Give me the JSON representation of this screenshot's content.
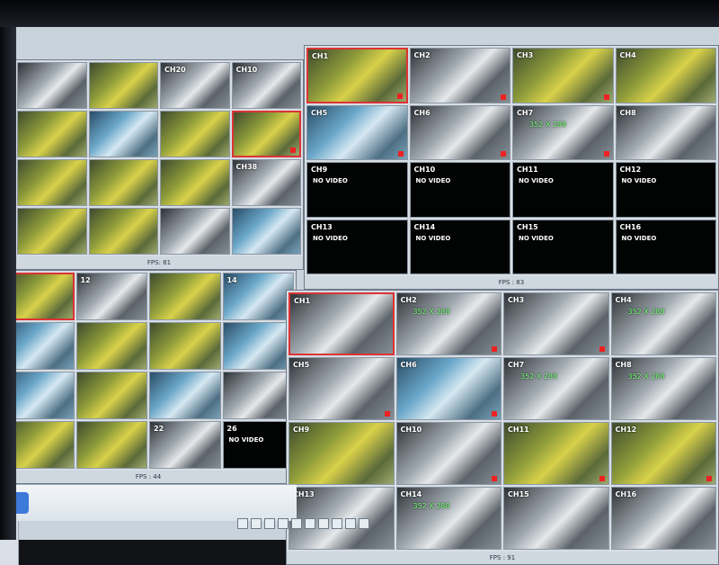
{
  "quad1": {
    "channels": [
      "",
      "",
      "CH20",
      "CH10",
      "",
      "",
      "",
      "",
      "",
      "",
      "",
      "CH38",
      "",
      "",
      "",
      ""
    ],
    "status": "FPS: 81"
  },
  "quad2": {
    "channels": [
      "CH1",
      "CH2",
      "CH3",
      "CH4",
      "CH5",
      "CH6",
      "CH7",
      "CH8",
      "CH9",
      "CH10",
      "CH11",
      "CH12",
      "CH13",
      "CH14",
      "CH15",
      "CH16"
    ],
    "no_video_label": "NO VIDEO",
    "resolution_label": "352 X 288",
    "status": "FPS : 83"
  },
  "quad3": {
    "channels": [
      "",
      "12",
      "",
      "14",
      "",
      "",
      "",
      "",
      "",
      "",
      "",
      "",
      "",
      "",
      "22",
      "26"
    ],
    "no_video_label": "NO VIDEO",
    "status": "FPS : 44"
  },
  "quad4": {
    "channels": [
      "CH1",
      "CH2",
      "CH3",
      "CH4",
      "CH5",
      "CH6",
      "CH7",
      "CH8",
      "CH9",
      "CH10",
      "CH11",
      "CH12",
      "CH13",
      "CH14",
      "CH15",
      "CH16"
    ],
    "resolution_label": "352 X 288",
    "status": "FPS : 91"
  }
}
